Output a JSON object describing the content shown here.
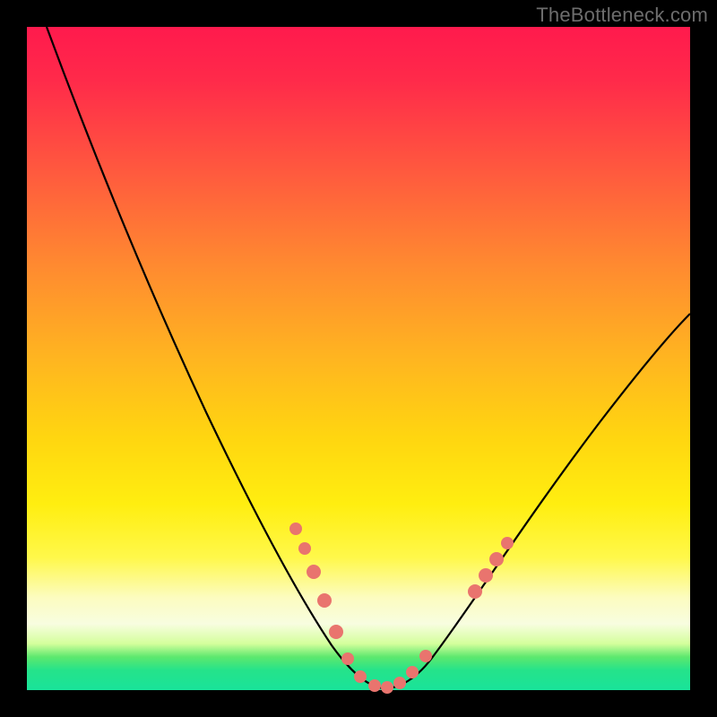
{
  "watermark": "TheBottleneck.com",
  "colors": {
    "frame": "#000000",
    "curve": "#000000",
    "marker": "#e9746e",
    "gradient_top": "#ff1a4d",
    "gradient_bottom": "#19e39a"
  },
  "chart_data": {
    "type": "line",
    "title": "",
    "xlabel": "",
    "ylabel": "",
    "xlim": [
      0,
      100
    ],
    "ylim": [
      0,
      100
    ],
    "annotations": [
      "TheBottleneck.com"
    ],
    "series": [
      {
        "name": "bottleneck-curve",
        "x": [
          3,
          8,
          14,
          20,
          26,
          32,
          37,
          41,
          44,
          47,
          50,
          53,
          56,
          59,
          62,
          66,
          72,
          80,
          88,
          96
        ],
        "values": [
          100,
          90,
          78,
          66,
          54,
          42,
          32,
          24,
          16,
          10,
          5,
          2,
          1,
          2,
          5,
          10,
          18,
          30,
          42,
          54
        ]
      }
    ],
    "markers": {
      "name": "highlighted-points",
      "x": [
        41,
        43,
        45,
        47,
        49,
        51,
        53,
        55,
        57,
        59,
        61,
        63,
        65,
        67
      ],
      "values": [
        24,
        19,
        14,
        10,
        6,
        3,
        1,
        1,
        2,
        4,
        7,
        11,
        16,
        22
      ]
    }
  }
}
